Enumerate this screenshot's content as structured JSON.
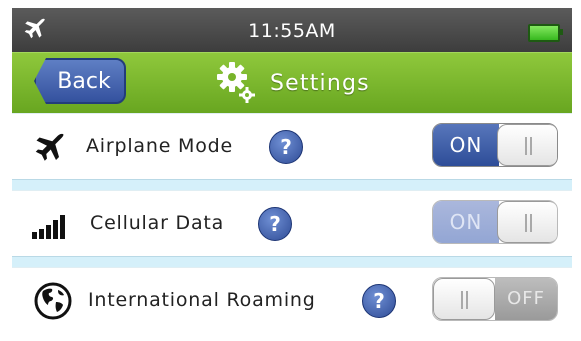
{
  "status_bar": {
    "time": "11:55AM",
    "plane_icon": "airplane-icon",
    "battery_icon": "battery-icon",
    "battery_color": "#37b81f"
  },
  "nav": {
    "back_label": "Back",
    "title": "Settings",
    "title_icon": "gear-icon",
    "bar_color": "#7cb82e",
    "back_color": "#3f5ca8"
  },
  "settings": [
    {
      "label": "Airplane Mode",
      "icon": "airplane-icon",
      "toggle_on_text": "ON",
      "toggle_state": "on",
      "enabled": true
    },
    {
      "label": "Cellular Data",
      "icon": "signal-bars-icon",
      "toggle_on_text": "ON",
      "toggle_state": "on",
      "enabled": false
    },
    {
      "label": "International Roaming",
      "icon": "globe-icon",
      "toggle_off_text": "OFF",
      "toggle_state": "off",
      "enabled": false
    }
  ],
  "help_glyph": "?",
  "colors": {
    "separator": "#d5f0fa",
    "toggle_on": "#3d5aa6",
    "help": "#3d5aa6"
  }
}
